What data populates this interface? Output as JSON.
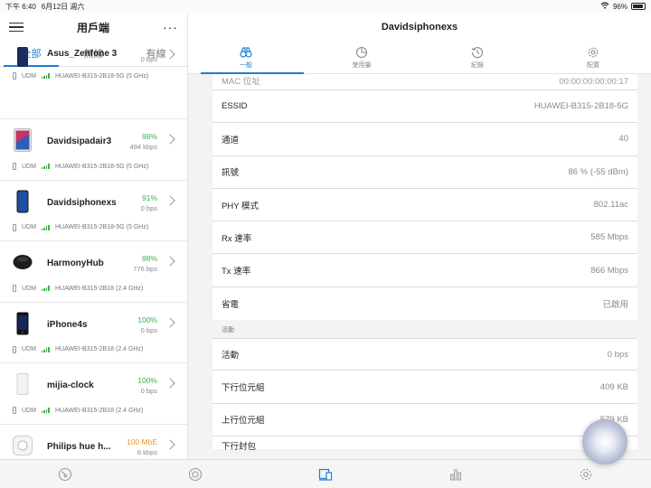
{
  "status": {
    "time": "下午 6:40",
    "date": "6月12日 週六",
    "battery": "96%"
  },
  "left": {
    "title": "用戶端",
    "more": "···",
    "tabs": [
      "全部",
      "無線",
      "有線"
    ],
    "devices": [
      {
        "name": "Asus_Zenfone 3",
        "pct": "",
        "rate": "0 bps",
        "ap": "UDM",
        "ssid": "HUAWEI-B315-2B18-5G (5 GHz)"
      },
      {
        "name": "Davidsipadair3",
        "pct": "98%",
        "rate": "494 kbps",
        "ap": "UDM",
        "ssid": "HUAWEI-B315-2B18-5G (5 GHz)"
      },
      {
        "name": "Davidsiphonexs",
        "pct": "91%",
        "rate": "0 bps",
        "ap": "UDM",
        "ssid": "HUAWEI-B315-2B18-5G (5 GHz)"
      },
      {
        "name": "HarmonyHub",
        "pct": "98%",
        "rate": "776 bps",
        "ap": "UDM",
        "ssid": "HUAWEI-B315-2B18 (2.4 GHz)"
      },
      {
        "name": "iPhone4s",
        "pct": "100%",
        "rate": "0 bps",
        "ap": "UDM",
        "ssid": "HUAWEI-B315-2B18 (2.4 GHz)"
      },
      {
        "name": "mijia-clock",
        "pct": "100%",
        "rate": "0 bps",
        "ap": "UDM",
        "ssid": "HUAWEI-B315-2B18 (2.4 GHz)"
      },
      {
        "name": "Philips hue h...",
        "pct": "100 MbE",
        "rate": "6 kbps",
        "ap": "",
        "ssid": ""
      }
    ]
  },
  "right": {
    "title": "Davidsiphonexs",
    "tabs": [
      "一般",
      "使用量",
      "紀錄",
      "配置"
    ],
    "clipped_row": {
      "k": "MAC 位址",
      "v": "00:00:00:00:00:17"
    },
    "rows": [
      {
        "k": "ESSID",
        "v": "HUAWEI-B315-2B18-5G"
      },
      {
        "k": "通道",
        "v": "40"
      },
      {
        "k": "訊號",
        "v": "86 % (-55 dBm)"
      },
      {
        "k": "PHY 模式",
        "v": "802.11ac"
      },
      {
        "k": "Rx 速率",
        "v": "585 Mbps"
      },
      {
        "k": "Tx 速率",
        "v": "866 Mbps"
      },
      {
        "k": "省電",
        "v": "已啟用"
      }
    ],
    "section": "活動",
    "activity": [
      {
        "k": "活動",
        "v": "0 bps"
      },
      {
        "k": "下行位元組",
        "v": "409 KB"
      },
      {
        "k": "上行位元組",
        "v": "579 KB"
      }
    ],
    "bottom_clip": "下行封包"
  },
  "colors": {
    "accent": "#1a7fd6",
    "good": "#3eb14a",
    "warn": "#e49b1b"
  }
}
